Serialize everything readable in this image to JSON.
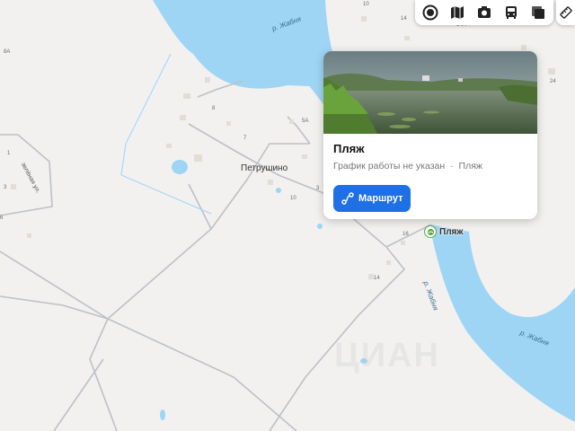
{
  "map": {
    "village_name": "Петрушино",
    "street_label": "зелёная ул.",
    "river_labels": [
      "р. Жабня",
      "р. Жабня",
      "р. Жабня"
    ],
    "house_numbers": [
      "8",
      "7",
      "5А",
      "3",
      "10",
      "16",
      "14",
      "14А",
      "24",
      "14",
      "1",
      "3",
      "6",
      "8А",
      "10"
    ],
    "watermark": "ЦИАН",
    "poi_label": "Пляж",
    "colors": {
      "water": "#9ed5f4",
      "land": "#f2f1ef",
      "road": "#bdc0c7",
      "accent": "#1f6fe5",
      "poi": "#5aa845"
    }
  },
  "toolbar": {
    "buttons": [
      {
        "name": "layers-icon"
      },
      {
        "name": "map-icon"
      },
      {
        "name": "camera-icon"
      },
      {
        "name": "bus-icon"
      },
      {
        "name": "panorama-icon"
      }
    ],
    "ruler": "ruler-icon"
  },
  "card": {
    "title": "Пляж",
    "subtitle": "График работы не указан",
    "category": "Пляж",
    "separator": "·",
    "route_button": "Маршрут"
  }
}
